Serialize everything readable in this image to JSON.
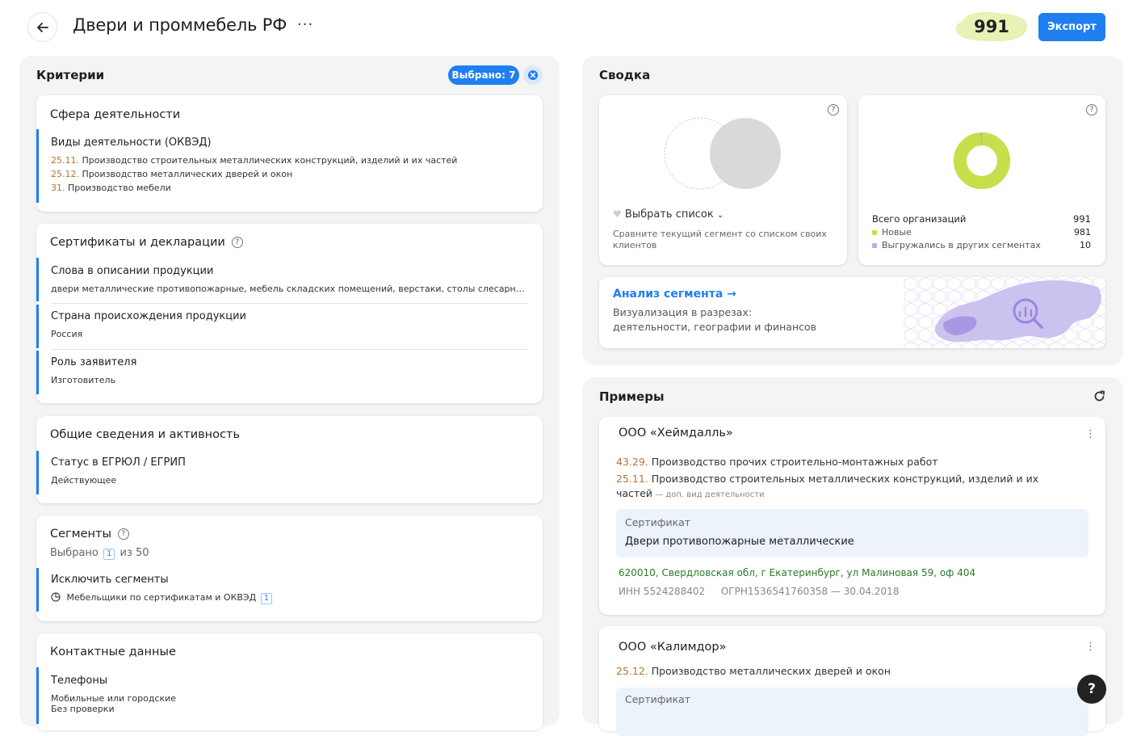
{
  "header": {
    "title": "Двери и проммебель РФ",
    "more": "···",
    "count": "991",
    "export_label": "Экспорт"
  },
  "criteria": {
    "title": "Критерии",
    "selected_badge": "Выбрано: 7",
    "activity": {
      "title": "Сфера деятельности",
      "okved_title": "Виды деятельности (ОКВЭД)",
      "items": [
        {
          "code": "25.11.",
          "text": " Производство строительных металлических конструкций, изделий и их частей"
        },
        {
          "code": "25.12.",
          "text": " Производство металлических дверей и окон"
        },
        {
          "code": "31.",
          "text": " Производство мебели"
        }
      ]
    },
    "certs": {
      "title": "Сертификаты и декларации",
      "words_title": "Слова в описании продукции",
      "words_value": "двери металлические противопожарные, мебель складских помещений, верстаки, столы слесарные, с...",
      "country_title": "Страна происхождения продукции",
      "country_value": "Россия",
      "role_title": "Роль заявителя",
      "role_value": "Изготовитель"
    },
    "general": {
      "title": "Общие сведения и активность",
      "status_title": "Статус в ЕГРЮЛ / ЕГРИП",
      "status_value": "Действующее"
    },
    "segments": {
      "title": "Сегменты",
      "selected_prefix": "Выбрано",
      "selected_count": "1",
      "selected_suffix": "из 50",
      "exclude_title": "Исключить сегменты",
      "exclude_item": "Мебельщики по сертификатам и ОКВЭД",
      "exclude_count": "1"
    },
    "contacts": {
      "title": "Контактные данные",
      "phones_title": "Телефоны",
      "phones_value": "Мобильные или городские",
      "phones_value2": "Без проверки"
    }
  },
  "summary": {
    "title": "Сводка",
    "compare": {
      "select_list": "Выбрать список",
      "desc": "Сравните текущий сегмент со списком своих клиентов"
    },
    "stats": {
      "total_label": "Всего организаций",
      "total_value": "991",
      "new_label": "Новые",
      "new_value": "981",
      "other_label": "Выгружались в других сегментах",
      "other_value": "10",
      "new_fraction": 0.99,
      "colors": {
        "new": "#c5e04a",
        "other": "#b7a9ea"
      }
    },
    "analysis": {
      "link": "Анализ сегмента →",
      "desc1": "Визуализация в разрезах:",
      "desc2": "деятельности, географии и финансов"
    }
  },
  "examples": {
    "title": "Примеры",
    "items": [
      {
        "name": "ООО «Хеймдалль»",
        "okved1_code": "43.29.",
        "okved1_text": " Производство прочих строительно-монтажных работ",
        "okved2_code": "25.11.",
        "okved2_text": " Производство строительных металлических конструкций, изделий и их",
        "okved2_text_cont": "частей",
        "okved2_note": " — доп. вид деятельности",
        "cert_label": "Сертификат",
        "cert_value": "Двери противопожарные металлические",
        "address": "620010, Свердловская обл, г Екатеринбург, ул Малиновая 59, оф 404",
        "inn": "ИНН 5524288402",
        "ogrn": "ОГРН1536541760358 — 30.04.2018"
      },
      {
        "name": "ООО «Калимдор»",
        "okved1_code": "25.12.",
        "okved1_text": " Производство металлических дверей и окон",
        "cert_label": "Сертификат"
      }
    ]
  },
  "help": "?"
}
